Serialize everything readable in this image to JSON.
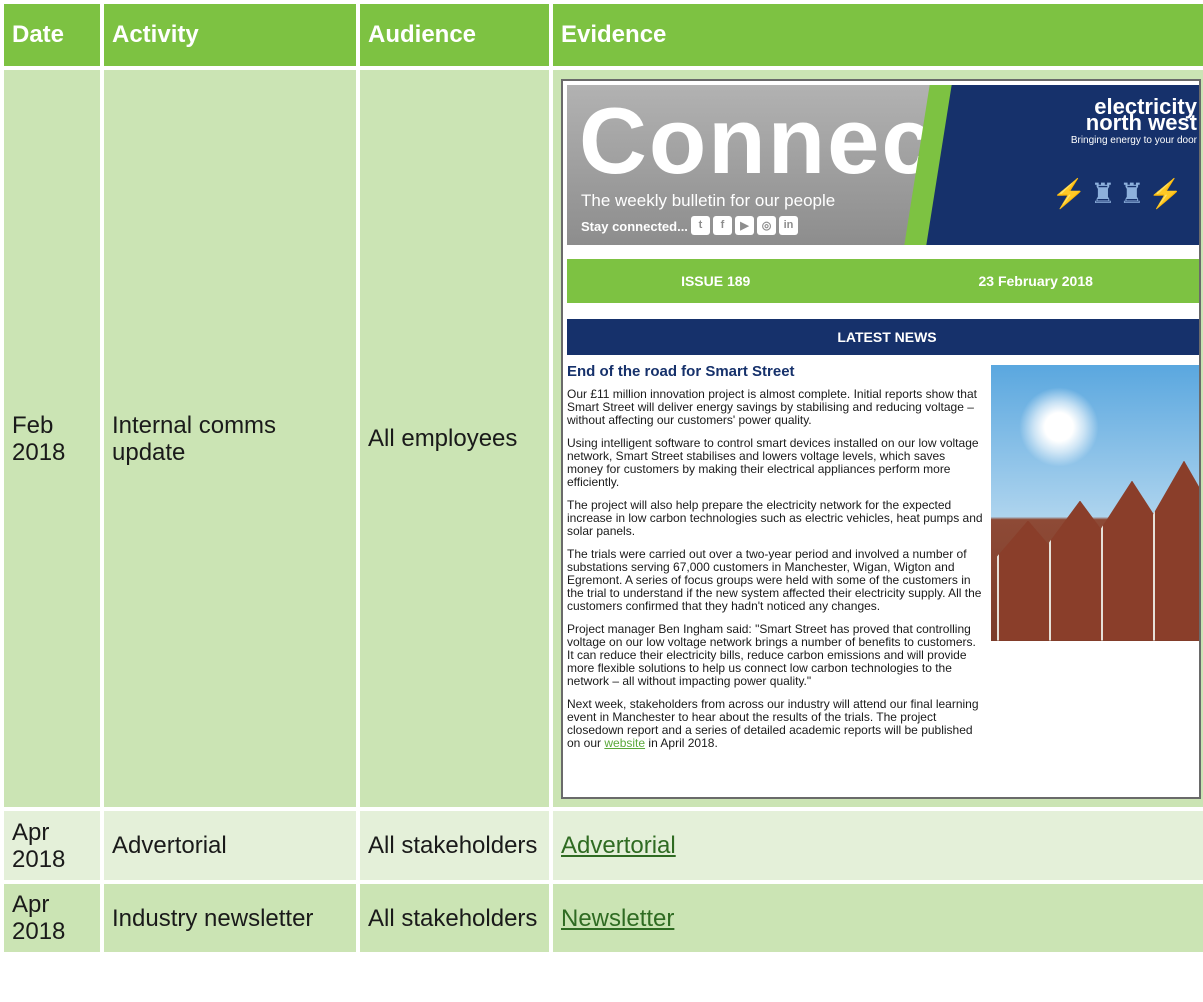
{
  "headers": [
    "Date",
    "Activity",
    "Audience",
    "Evidence"
  ],
  "rows": [
    {
      "date": "Feb 2018",
      "activity": "Internal comms update",
      "audience": "All employees"
    },
    {
      "date": "Apr 2018",
      "activity": "Advertorial",
      "audience": "All stakeholders",
      "evidence_link": "Advertorial"
    },
    {
      "date": "Apr 2018",
      "activity": "Industry newsletter",
      "audience": "All stakeholders",
      "evidence_link": "Newsletter"
    }
  ],
  "newsletter": {
    "title": "Connect",
    "subtitle": "The weekly bulletin for our people",
    "stay_connected": "Stay connected...",
    "social_icons": [
      "twitter-icon",
      "facebook-icon",
      "youtube-icon",
      "instagram-icon",
      "linkedin-icon"
    ],
    "brand_name_line1": "electricity",
    "brand_name_line2": "north west",
    "brand_tagline": "Bringing energy to your door",
    "issue": "ISSUE 189",
    "issue_date": "23 February 2018",
    "section": "LATEST NEWS",
    "headline": "End of the road for Smart Street",
    "paragraphs": [
      "Our £11 million innovation project is almost complete. Initial reports show that Smart Street will deliver energy savings by stabilising and reducing voltage – without affecting our customers' power quality.",
      "Using intelligent software to control smart devices installed on our low voltage network, Smart Street stabilises and lowers voltage levels, which saves money for customers by making their electrical appliances perform more efficiently.",
      "The project will also help prepare the electricity network for the expected increase in low carbon technologies such as electric vehicles, heat pumps and solar panels.",
      "The trials were carried out over a two-year period and involved a number of substations serving 67,000 customers in Manchester, Wigan, Wigton and Egremont. A series of focus groups were held with some of the customers in the trial to understand if the new system affected their electricity supply. All the customers confirmed that they hadn't noticed any changes.",
      "Project manager Ben Ingham said: \"Smart Street has proved that controlling voltage on our low voltage network brings a number of benefits to customers. It can reduce their electricity bills, reduce carbon emissions and will provide more flexible solutions to help us connect low carbon technologies to the network – all without impacting power quality.\""
    ],
    "last_paragraph_before": "Next week, stakeholders from across our industry will attend our final learning event in Manchester to hear about the results of the trials. The project closedown report and a series of detailed academic reports will be published on our",
    "last_paragraph_link": "website",
    "last_paragraph_after": "in April 2018."
  },
  "colors": {
    "header": "#7dc242",
    "row_dark": "#cbe4b4",
    "row_light": "#e4f0d9",
    "navy": "#16316b"
  }
}
